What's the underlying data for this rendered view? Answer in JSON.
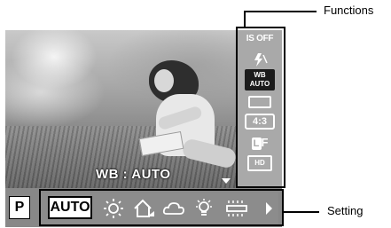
{
  "screen": {
    "overlay_text": "WB : AUTO"
  },
  "functions_panel": {
    "items": [
      {
        "id": "is",
        "label": "IS OFF",
        "icon": "image-stabilizer-icon"
      },
      {
        "id": "flash",
        "label": "",
        "icon": "flash-icon"
      },
      {
        "id": "wb",
        "label_line1": "WB",
        "label_line2": "AUTO",
        "icon": "white-balance-icon"
      },
      {
        "id": "drive",
        "label": "",
        "icon": "single-shot-icon"
      },
      {
        "id": "aspect",
        "label": "4:3",
        "icon": "aspect-ratio-icon"
      },
      {
        "id": "quality",
        "label_badge": "L",
        "label_suffix": "F",
        "icon": "image-quality-icon"
      },
      {
        "id": "movie",
        "label": "HD",
        "icon": "movie-quality-icon"
      }
    ]
  },
  "setting_bar": {
    "mode": "P",
    "selected_option": "AUTO",
    "options_icons": [
      "sunny-icon",
      "shade-icon",
      "cloudy-icon",
      "incandescent-icon",
      "fluorescent-icon"
    ]
  },
  "callouts": {
    "functions": "Functions",
    "setting": "Setting"
  },
  "colors": {
    "screen_bg": "#7a7a7a",
    "panel_bg": "#a9a9a9",
    "icon": "#ffffff",
    "selected_bg": "#ffffff"
  }
}
